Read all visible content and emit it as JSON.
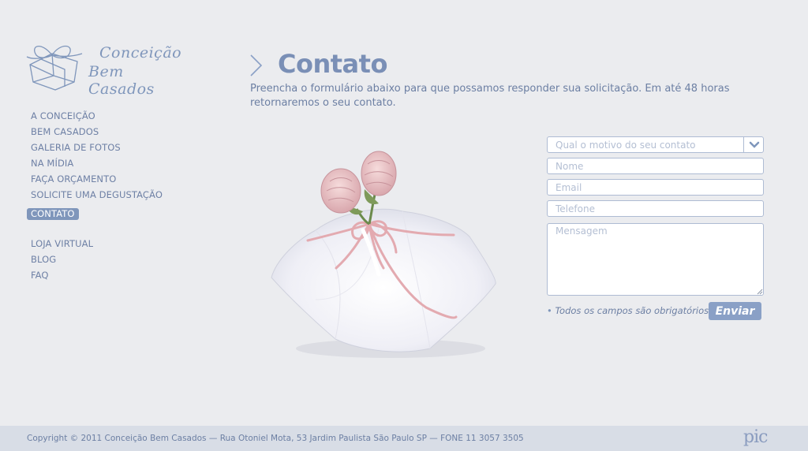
{
  "brand": {
    "logo_line1": "Conceição",
    "logo_line2": "Bem Casados"
  },
  "nav": {
    "primary": [
      {
        "label": "A CONCEIÇÃO"
      },
      {
        "label": "BEM CASADOS"
      },
      {
        "label": "GALERIA DE FOTOS"
      },
      {
        "label": "NA MÍDIA"
      },
      {
        "label": "FAÇA ORÇAMENTO"
      },
      {
        "label": "SOLICITE UMA DEGUSTAÇÃO"
      },
      {
        "label": "CONTATO"
      }
    ],
    "secondary": [
      {
        "label": "LOJA VIRTUAL"
      },
      {
        "label": "BLOG"
      },
      {
        "label": "FAQ"
      }
    ],
    "active": "CONTATO"
  },
  "page": {
    "title": "Contato",
    "intro": "Preencha o formulário abaixo para que possamos responder sua solicitação. Em até 48 horas retornaremos o seu contato."
  },
  "form": {
    "reason_placeholder": "Qual o motivo do seu contato",
    "name_placeholder": "Nome",
    "email_placeholder": "Email",
    "phone_placeholder": "Telefone",
    "message_placeholder": "Mensagem",
    "required_note": "Todos os campos são obrigatórios",
    "submit_label": "Enviar"
  },
  "footer": {
    "copyright": "Copyright © 2011 Conceição Bem Casados  — Rua Otoniel Mota, 53 Jardim Paulista São Paulo SP — FONE 11 3057 3505",
    "agency": "pic"
  },
  "colors": {
    "background": "#ebecef",
    "accent": "#7f96bb",
    "text": "#6c7fa3",
    "footer_bg": "#d8dde6"
  }
}
